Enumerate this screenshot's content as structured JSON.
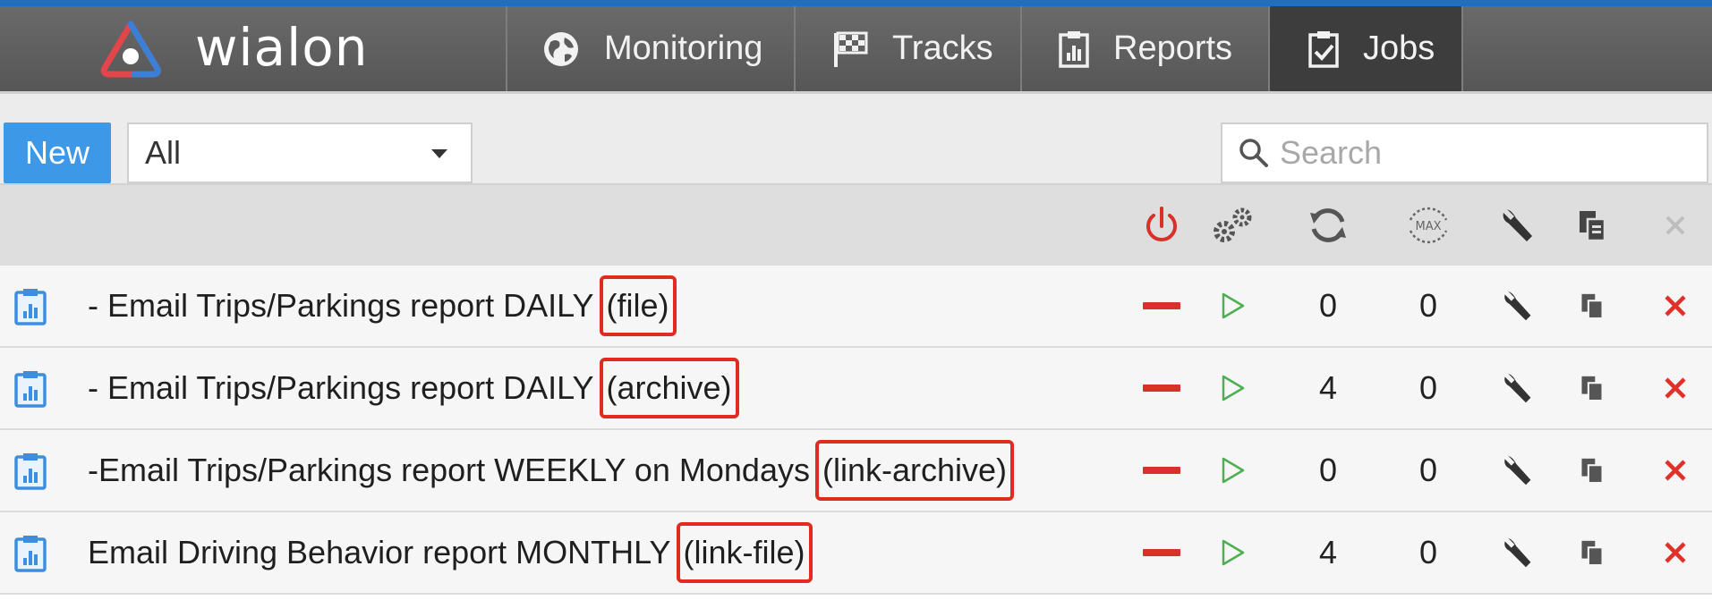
{
  "app": {
    "logo_text": "wialon",
    "colors": {
      "accent": "#1e6fbf",
      "new_button": "#3d98e8",
      "highlight": "#e02b20",
      "disabled_dash": "#d9302a",
      "run": "#4caf50",
      "delete": "#e0302a"
    }
  },
  "nav": {
    "tabs": [
      {
        "label": "Monitoring",
        "icon": "globe-icon"
      },
      {
        "label": "Tracks",
        "icon": "checkered-flag-icon"
      },
      {
        "label": "Reports",
        "icon": "report-clipboard-icon"
      },
      {
        "label": "Jobs",
        "icon": "jobs-clipboard-icon",
        "active": true
      }
    ]
  },
  "toolbar": {
    "new_label": "New",
    "filter_value": "All",
    "search_placeholder": "Search"
  },
  "table": {
    "header_icons": [
      "power-icon",
      "gears-icon",
      "refresh-icon",
      "max-icon",
      "wrench-icon",
      "copy-icon",
      "close-icon"
    ],
    "rows": [
      {
        "icon": "report-job-icon",
        "name": "- Email Trips/Parkings report DAILY",
        "tag": "(file)",
        "enabled": false,
        "count": "0",
        "max": "0"
      },
      {
        "icon": "report-job-icon",
        "name": "- Email Trips/Parkings report DAILY",
        "tag": "(archive)",
        "enabled": false,
        "count": "4",
        "max": "0"
      },
      {
        "icon": "report-job-icon",
        "name": "-Email Trips/Parkings report WEEKLY on Mondays",
        "tag": "(link-archive)",
        "enabled": false,
        "count": "0",
        "max": "0"
      },
      {
        "icon": "report-job-icon",
        "name": "Email Driving Behavior report MONTHLY",
        "tag": "(link-file)",
        "enabled": false,
        "count": "4",
        "max": "0"
      }
    ]
  }
}
